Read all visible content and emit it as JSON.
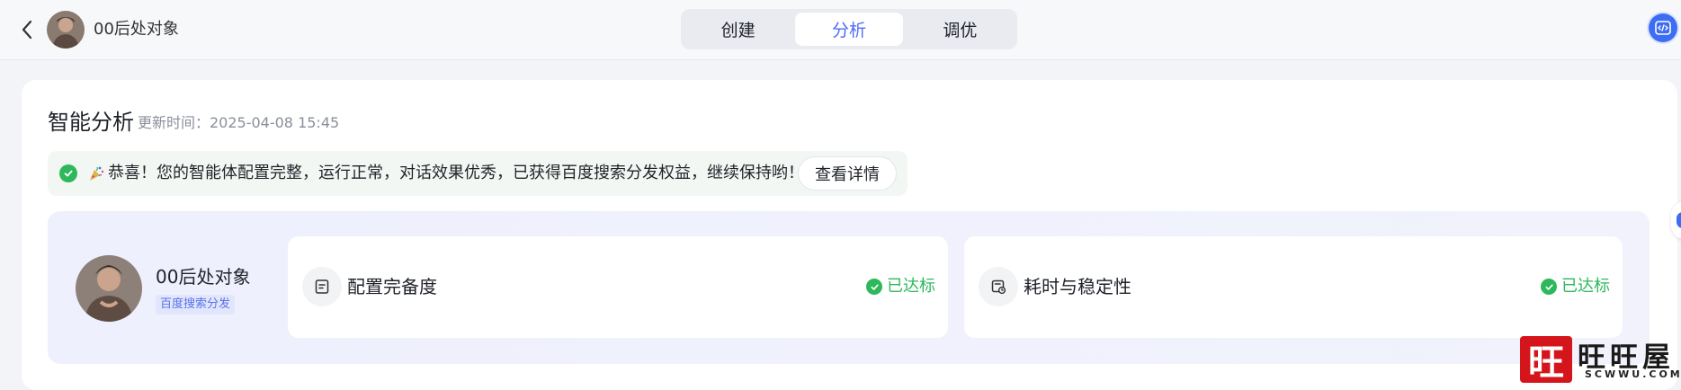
{
  "header": {
    "agent_name": "00后处对象",
    "tabs": [
      {
        "label": "创建",
        "active": false
      },
      {
        "label": "分析",
        "active": true
      },
      {
        "label": "调优",
        "active": false
      }
    ]
  },
  "analysis": {
    "title": "智能分析",
    "update_label": "更新时间：2025-04-08 15:45",
    "banner_text": "恭喜！您的智能体配置完整，运行正常，对话效果优秀，已获得百度搜索分发权益，继续保持哟！",
    "detail_button": "查看详情",
    "agent": {
      "name": "00后处对象",
      "tag": "百度搜索分发"
    },
    "metrics": [
      {
        "label": "配置完备度",
        "status": "已达标"
      },
      {
        "label": "耗时与稳定性",
        "status": "已达标"
      }
    ]
  },
  "watermark": {
    "box_char": "旺",
    "text": "旺旺屋",
    "sub": "SCWWU.COM"
  },
  "colors": {
    "accent": "#4e6bf5",
    "success": "#2eb85c",
    "code_button": "#3d6df2",
    "watermark_red": "#d4151b"
  },
  "icons": {
    "back": "chevron-left-icon",
    "code": "code-icon",
    "success": "check-circle-icon",
    "party": "party-popper-icon",
    "config": "document-icon",
    "timing": "timer-icon"
  }
}
